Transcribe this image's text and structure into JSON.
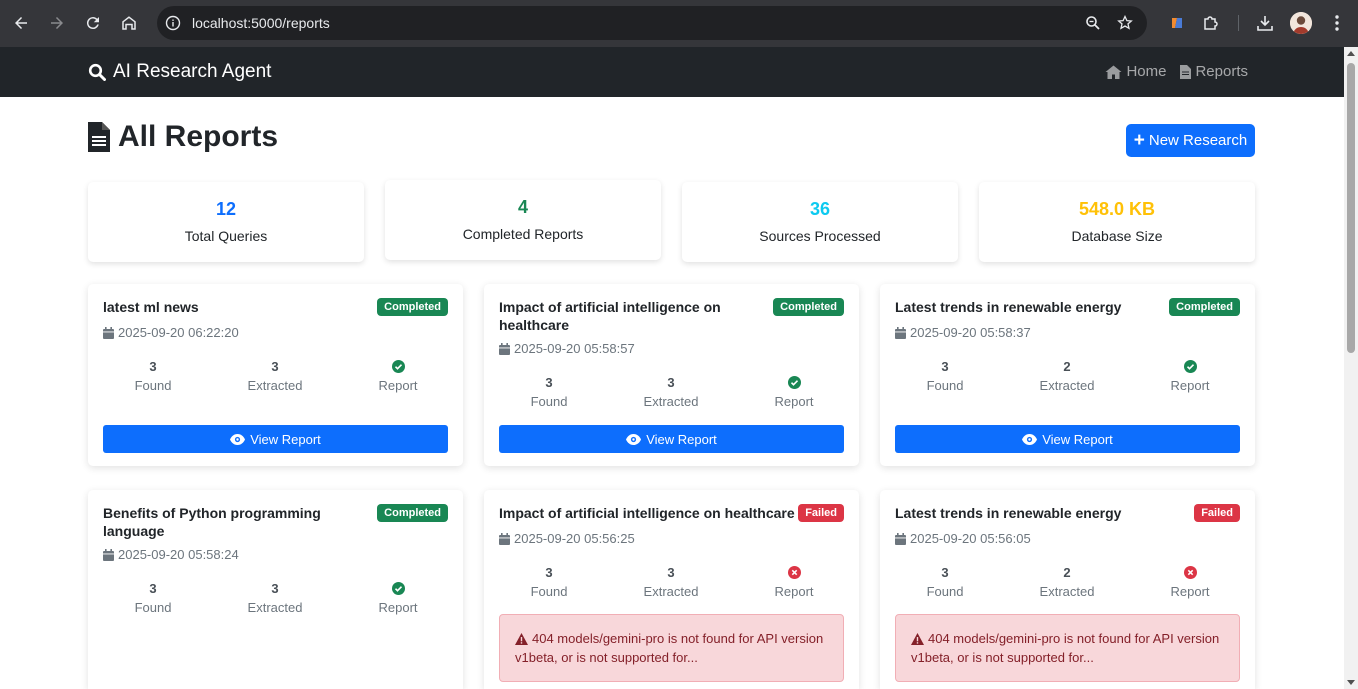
{
  "browser": {
    "url": "localhost:5000/reports"
  },
  "navbar": {
    "brand": "AI Research Agent",
    "links": [
      {
        "label": "Home",
        "icon": "home-icon"
      },
      {
        "label": "Reports",
        "icon": "file-icon"
      }
    ]
  },
  "page": {
    "title": "All Reports",
    "new_button": "New Research"
  },
  "stats": [
    {
      "value": "12",
      "label": "Total Queries",
      "color": "#0d6efd"
    },
    {
      "value": "4",
      "label": "Completed Reports",
      "color": "#198754"
    },
    {
      "value": "36",
      "label": "Sources Processed",
      "color": "#0dcaf0"
    },
    {
      "value": "548.0 KB",
      "label": "Database Size",
      "color": "#ffc107"
    }
  ],
  "reports": [
    {
      "title": "latest ml news",
      "status": "Completed",
      "date": "2025-09-20 06:22:20",
      "found": "3",
      "found_label": "Found",
      "extracted": "3",
      "extracted_label": "Extracted",
      "report_label": "Report",
      "button": "View Report"
    },
    {
      "title": "Impact of artificial intelligence on healthcare",
      "status": "Completed",
      "date": "2025-09-20 05:58:57",
      "found": "3",
      "found_label": "Found",
      "extracted": "3",
      "extracted_label": "Extracted",
      "report_label": "Report",
      "button": "View Report"
    },
    {
      "title": "Latest trends in renewable energy",
      "status": "Completed",
      "date": "2025-09-20 05:58:37",
      "found": "3",
      "found_label": "Found",
      "extracted": "2",
      "extracted_label": "Extracted",
      "report_label": "Report",
      "button": "View Report"
    },
    {
      "title": "Benefits of Python programming language",
      "status": "Completed",
      "date": "2025-09-20 05:58:24",
      "found": "3",
      "found_label": "Found",
      "extracted": "3",
      "extracted_label": "Extracted",
      "report_label": "Report"
    },
    {
      "title": "Impact of artificial intelligence on healthcare",
      "status": "Failed",
      "date": "2025-09-20 05:56:25",
      "found": "3",
      "found_label": "Found",
      "extracted": "3",
      "extracted_label": "Extracted",
      "report_label": "Report",
      "error": "404 models/gemini-pro is not found for API version v1beta, or is not supported for..."
    },
    {
      "title": "Latest trends in renewable energy",
      "status": "Failed",
      "date": "2025-09-20 05:56:05",
      "found": "3",
      "found_label": "Found",
      "extracted": "2",
      "extracted_label": "Extracted",
      "report_label": "Report",
      "error": "404 models/gemini-pro is not found for API version v1beta, or is not supported for..."
    }
  ]
}
